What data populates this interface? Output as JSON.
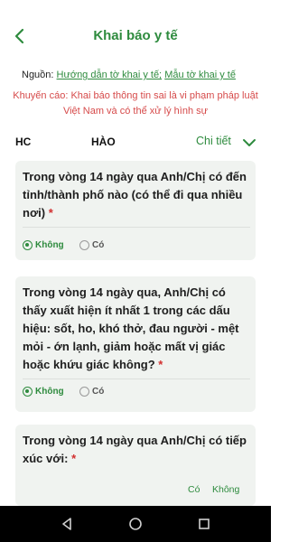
{
  "header": {
    "title": "Khai báo y tế"
  },
  "source": {
    "label": "Nguồn:",
    "link1": "Hướng dẫn tờ khai y tế;",
    "link2": "Mẫu tờ khai y tế"
  },
  "warning": "Khuyến cáo: Khai báo thông tin sai là vi phạm pháp luật Việt Nam và có thể xử lý hình sự",
  "person": {
    "name_left": "HC",
    "name_right": "HÀO",
    "details_label": "Chi tiết"
  },
  "questions": [
    {
      "text": "Trong vòng 14 ngày qua Anh/Chị có đến tỉnh/thành phố nào (có thể đi qua nhiều nơi)",
      "required": "*",
      "options": [
        "Không",
        "Có"
      ],
      "selected": "Không"
    },
    {
      "text": "Trong vòng 14 ngày qua, Anh/Chị có thấy xuất hiện ít nhất 1 trong các dấu hiệu: sốt, ho, khó thở, đau người - mệt mỏi - ớn lạnh, giảm hoặc mất vị giác hoặc khứu giác không?",
      "required": "*",
      "options": [
        "Không",
        "Có"
      ],
      "selected": "Không"
    },
    {
      "text": "Trong vòng 14 ngày qua Anh/Chị có tiếp xúc với:",
      "required": "*",
      "options": [
        "Có",
        "Không"
      ]
    }
  ],
  "colors": {
    "accent": "#2e8b3e",
    "warning": "#d64a4a",
    "card": "#f0f3f0",
    "navbar": "#000000"
  },
  "icons": {
    "back": "chevron-left-icon",
    "details": "chevron-down-icon",
    "nav": [
      "triangle-back-icon",
      "circle-home-icon",
      "square-recent-icon"
    ]
  }
}
